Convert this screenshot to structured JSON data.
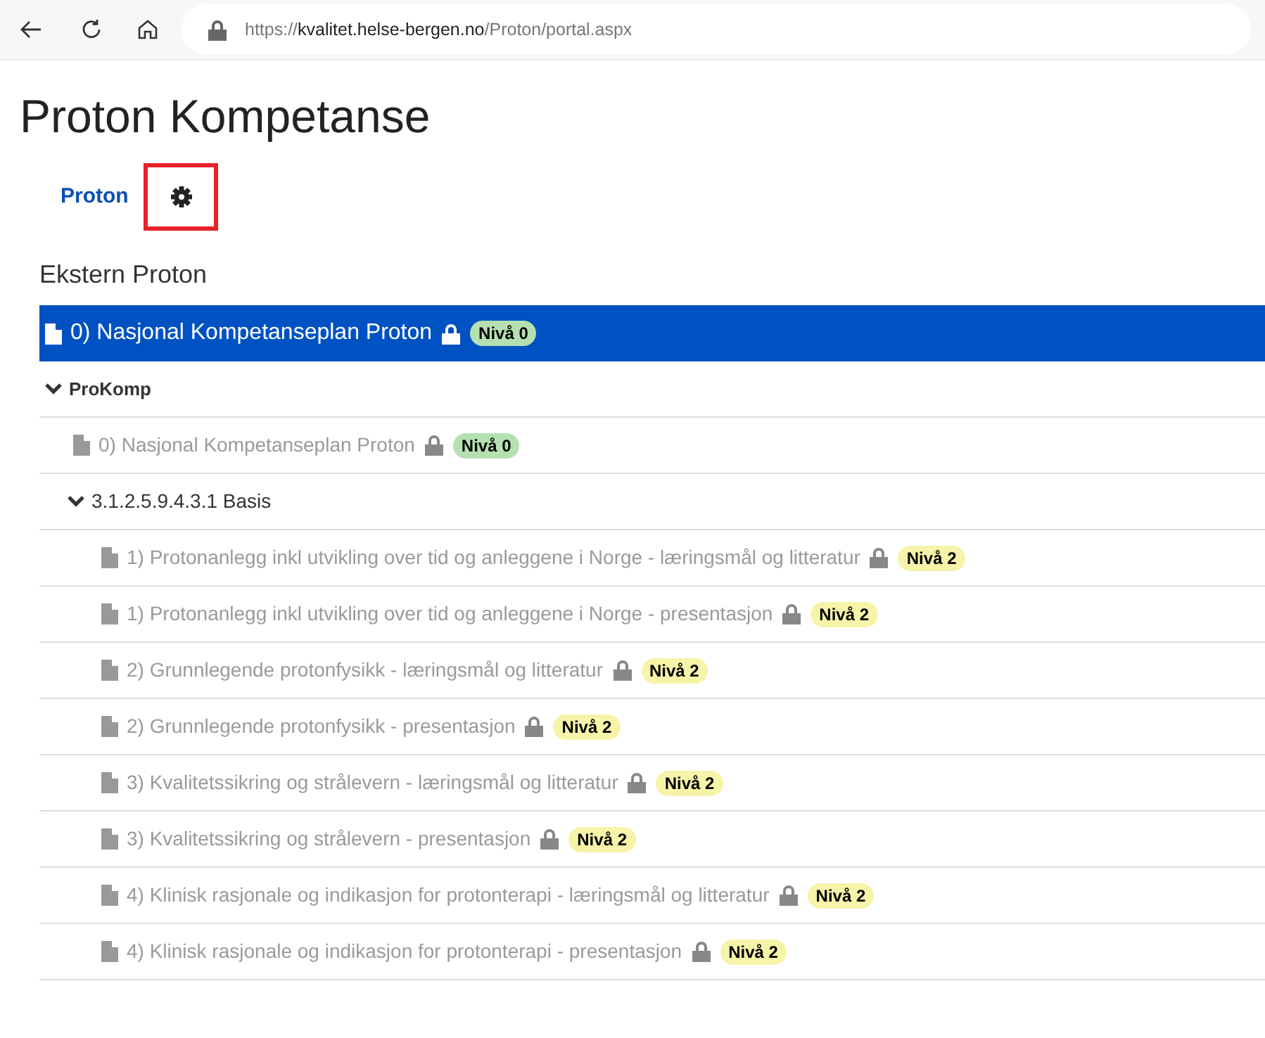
{
  "browser": {
    "url": [
      {
        "text": "https://",
        "kind": "dim"
      },
      {
        "text": "kvalitet.helse-bergen.no",
        "kind": "host"
      },
      {
        "text": "/Proton/portal.aspx",
        "kind": "dim"
      }
    ]
  },
  "page_title": "Proton Kompetanse",
  "nav": {
    "link": "Proton",
    "settings_highlighted": true
  },
  "section_title": "Ekstern Proton",
  "tree": [
    {
      "kind": "document",
      "label": "0) Nasjonal Kompetanseplan Proton",
      "locked": true,
      "badge": {
        "text": "Nivå 0",
        "color": "#b5e0b0"
      },
      "selected": true
    },
    {
      "kind": "folder",
      "label": "ProKomp",
      "bold": true,
      "expanded": true,
      "children": [
        {
          "kind": "document",
          "label": "0) Nasjonal Kompetanseplan Proton",
          "locked": true,
          "badge": {
            "text": "Nivå 0",
            "color": "#b5e0b0"
          },
          "selected": false
        },
        {
          "kind": "folder",
          "label": "3.1.2.5.9.4.3.1 Basis",
          "bold": false,
          "expanded": true,
          "children": [
            {
              "kind": "document",
              "label": "1) Protonanlegg inkl utvikling over tid og anleggene i Norge - læringsmål og litteratur",
              "locked": true,
              "badge": {
                "text": "Nivå 2",
                "color": "#f7f3a8"
              },
              "selected": false
            },
            {
              "kind": "document",
              "label": "1) Protonanlegg inkl utvikling over tid og anleggene i Norge - presentasjon",
              "locked": true,
              "badge": {
                "text": "Nivå 2",
                "color": "#f7f3a8"
              },
              "selected": false
            },
            {
              "kind": "document",
              "label": "2) Grunnlegende protonfysikk - læringsmål og litteratur",
              "locked": true,
              "badge": {
                "text": "Nivå 2",
                "color": "#f7f3a8"
              },
              "selected": false
            },
            {
              "kind": "document",
              "label": "2) Grunnlegende protonfysikk - presentasjon",
              "locked": true,
              "badge": {
                "text": "Nivå 2",
                "color": "#f7f3a8"
              },
              "selected": false
            },
            {
              "kind": "document",
              "label": "3) Kvalitetssikring og strålevern - læringsmål og litteratur",
              "locked": true,
              "badge": {
                "text": "Nivå 2",
                "color": "#f7f3a8"
              },
              "selected": false
            },
            {
              "kind": "document",
              "label": "3) Kvalitetssikring og strålevern - presentasjon",
              "locked": true,
              "badge": {
                "text": "Nivå 2",
                "color": "#f7f3a8"
              },
              "selected": false
            },
            {
              "kind": "document",
              "label": "4) Klinisk rasjonale og indikasjon for protonterapi - læringsmål og litteratur",
              "locked": true,
              "badge": {
                "text": "Nivå 2",
                "color": "#f7f3a8"
              },
              "selected": false
            },
            {
              "kind": "document",
              "label": "4) Klinisk rasjonale og indikasjon for protonterapi - presentasjon",
              "locked": true,
              "badge": {
                "text": "Nivå 2",
                "color": "#f7f3a8"
              },
              "selected": false
            }
          ]
        }
      ]
    }
  ]
}
